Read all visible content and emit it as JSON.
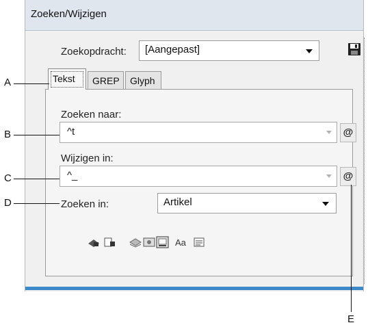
{
  "dialog": {
    "title": "Zoeken/Wijzigen",
    "query_label": "Zoekopdracht:",
    "query_value": "[Aangepast]"
  },
  "tabs": [
    {
      "label": "Tekst",
      "active": true
    },
    {
      "label": "GREP",
      "active": false
    },
    {
      "label": "Glyph",
      "active": false
    }
  ],
  "find": {
    "label": "Zoeken naar:",
    "value": "^t"
  },
  "change": {
    "label": "Wijzigen in:",
    "value": "^_"
  },
  "search_in": {
    "label": "Zoeken in:",
    "value": "Artikel"
  },
  "special_char_button": "@",
  "case_option_label": "Aa",
  "icons": [
    "save-icon",
    "locked-layers-icon",
    "locked-stories-icon",
    "hidden-layers-icon",
    "master-pages-icon",
    "footnotes-icon",
    "case-sensitive-icon",
    "whole-word-icon"
  ],
  "callouts": [
    "A",
    "B",
    "C",
    "D",
    "E"
  ],
  "colors": {
    "titlebar": "#dfe6ee",
    "accent": "#3b89c9"
  }
}
